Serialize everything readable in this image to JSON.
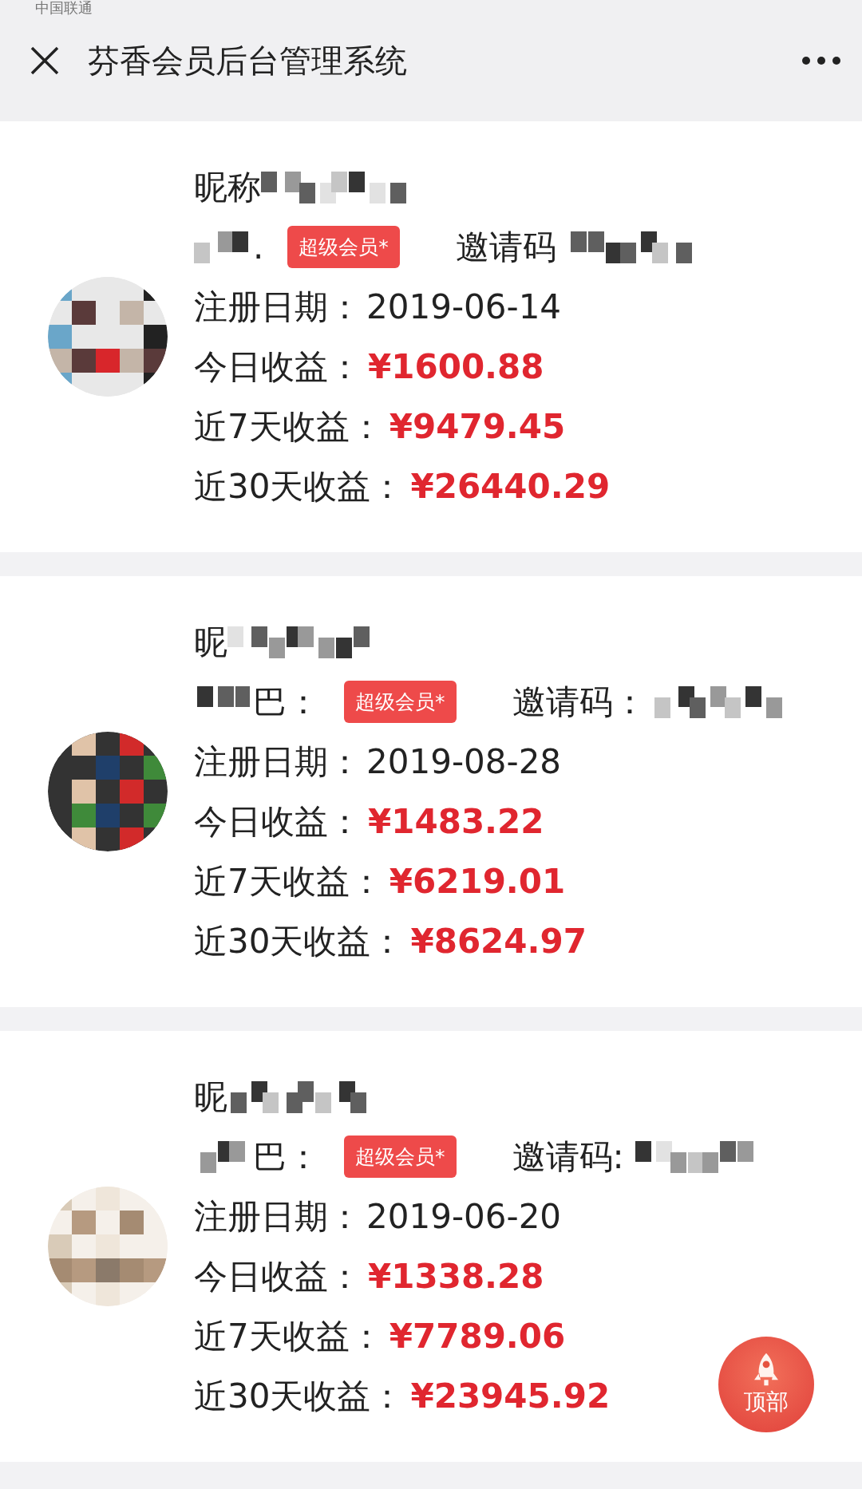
{
  "header": {
    "carrier": "中国联通",
    "title": "芬香会员后台管理系统"
  },
  "members": [
    {
      "name_label": "昵称",
      "role_label": ".",
      "badge": "超级会员*",
      "invite_label": "邀请码",
      "reg_label": "注册日期：",
      "reg_date": "2019-06-14",
      "stats": [
        {
          "label": "今日收益：",
          "value": "¥1600.88"
        },
        {
          "label": "近7天收益：",
          "value": "¥9479.45"
        },
        {
          "label": "近30天收益：",
          "value": "¥26440.29"
        }
      ]
    },
    {
      "name_label": "昵",
      "role_label": "巴：",
      "badge": "超级会员*",
      "invite_label": "邀请码：",
      "reg_label": "注册日期：",
      "reg_date": "2019-08-28",
      "stats": [
        {
          "label": "今日收益：",
          "value": "¥1483.22"
        },
        {
          "label": "近7天收益：",
          "value": "¥6219.01"
        },
        {
          "label": "近30天收益：",
          "value": "¥8624.97"
        }
      ]
    },
    {
      "name_label": "昵",
      "role_label": "巴：",
      "badge": "超级会员*",
      "invite_label": "邀请码:",
      "reg_label": "注册日期：",
      "reg_date": "2019-06-20",
      "stats": [
        {
          "label": "今日收益：",
          "value": "¥1338.28"
        },
        {
          "label": "近7天收益：",
          "value": "¥7789.06"
        },
        {
          "label": "近30天收益：",
          "value": "¥23945.92"
        }
      ]
    }
  ],
  "top_button": "顶部"
}
